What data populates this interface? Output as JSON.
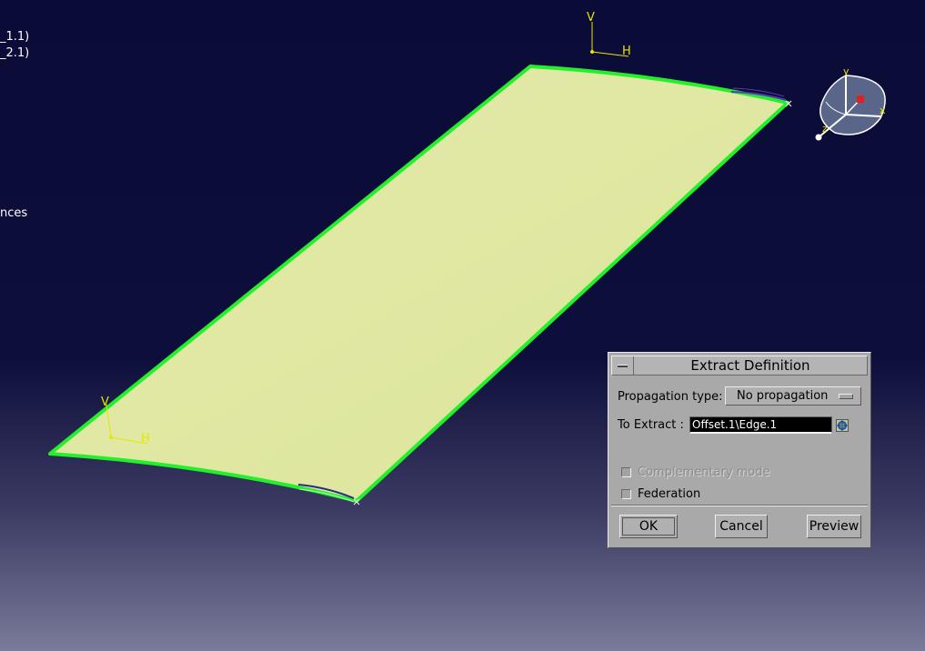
{
  "tree_fragments": {
    "line1": "_1.1)",
    "line2": "_2.1)",
    "line3": "nces"
  },
  "viewport_labels": {
    "axis_v": "V",
    "axis_h": "H"
  },
  "compass": {
    "labels": [
      "y",
      "z",
      "x"
    ]
  },
  "colors": {
    "background_top": "#0b0b37",
    "background_bottom": "#7a7a9a",
    "surface_fill": "#e1e9a2",
    "surface_edge": "#22f02a",
    "axis_color": "#e6e600"
  },
  "dialog": {
    "title": "Extract Definition",
    "propagation_label": "Propagation type:",
    "propagation_value": "No propagation",
    "to_extract_label": "To Extract :",
    "to_extract_value": "Offset.1\\Edge.1",
    "complementary_label": "Complementary mode",
    "complementary_checked": false,
    "complementary_enabled": false,
    "federation_label": "Federation",
    "federation_checked": false,
    "ok_label": "OK",
    "cancel_label": "Cancel",
    "preview_label": "Preview"
  }
}
